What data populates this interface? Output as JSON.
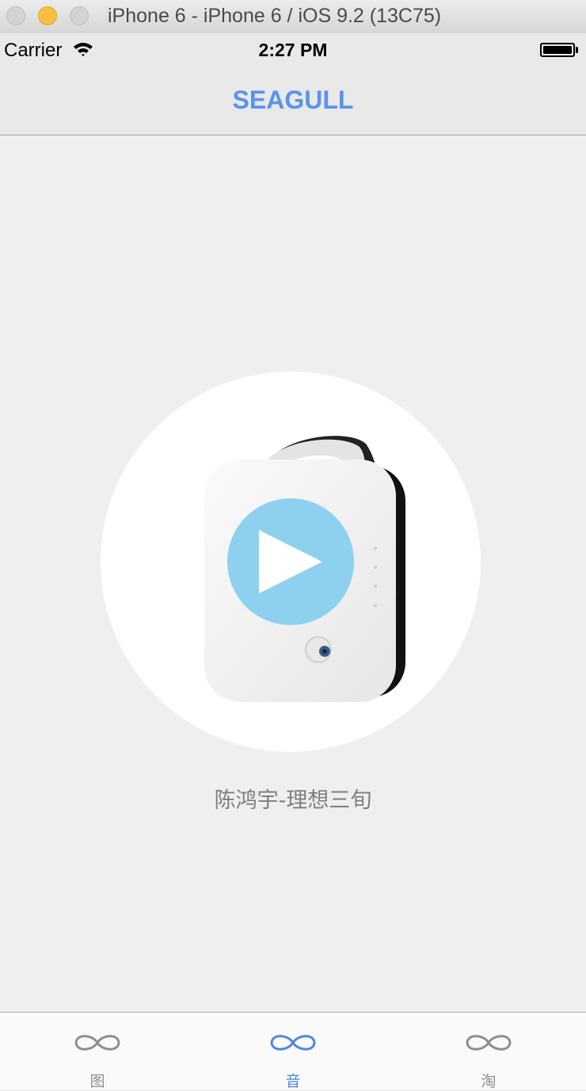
{
  "window": {
    "title": "iPhone 6 - iPhone 6 / iOS 9.2 (13C75)"
  },
  "status_bar": {
    "carrier": "Carrier",
    "time": "2:27 PM",
    "battery_level": 1.0
  },
  "nav": {
    "title": "SEAGULL",
    "title_color": "#5b93e8"
  },
  "player": {
    "song_title": "陈鸿宇-理想三旬",
    "play_button_color": "#8dd1ef",
    "play_icon": "play-icon"
  },
  "tabs": [
    {
      "label": "图",
      "icon": "infinity-icon",
      "active": false
    },
    {
      "label": "音",
      "icon": "infinity-icon",
      "active": true
    },
    {
      "label": "淘",
      "icon": "infinity-icon",
      "active": false
    }
  ],
  "colors": {
    "accent": "#4f86e0",
    "inactive": "#8e8e8e",
    "background": "#efefef"
  }
}
